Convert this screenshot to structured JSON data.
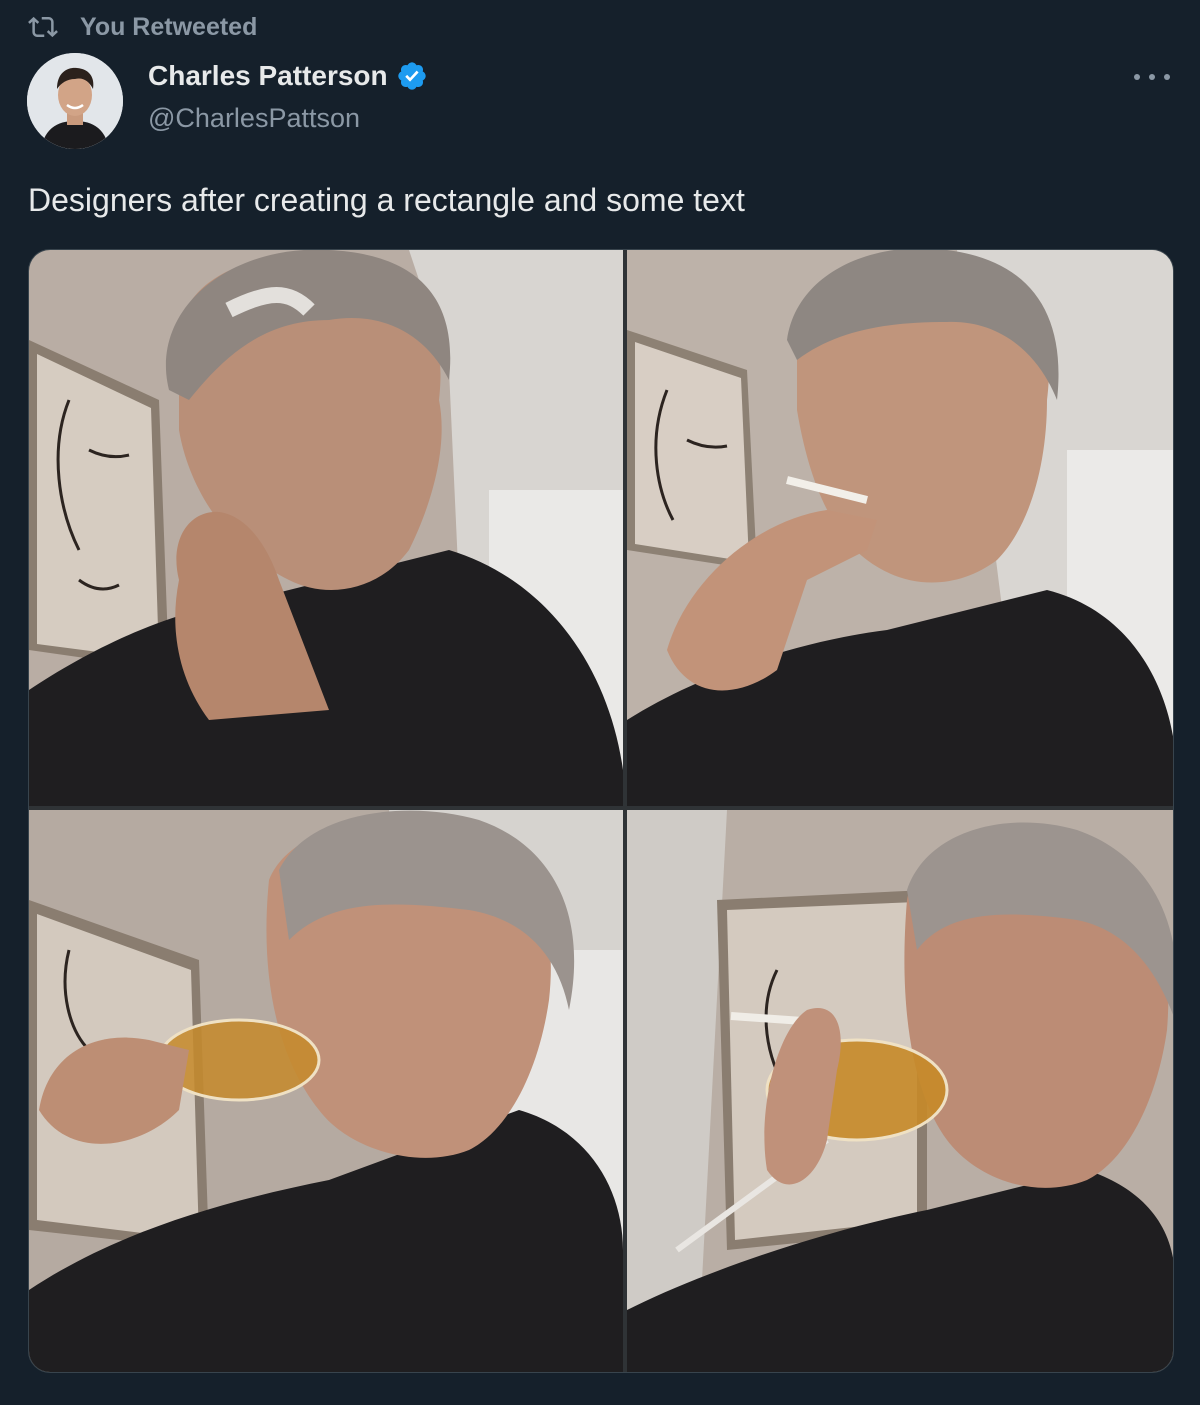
{
  "social_context": {
    "icon": "retweet-icon",
    "text": "You Retweeted"
  },
  "author": {
    "display_name": "Charles Patterson",
    "handle": "@CharlesPattson",
    "verified": true,
    "verified_icon": "verified-badge-icon",
    "avatar_icon": "avatar"
  },
  "more_icon": "more-options-icon",
  "tweet": {
    "text": "Designers after creating a rectangle and some text"
  },
  "media": {
    "count": 4,
    "items": [
      {
        "icon": "photo-man-hand-on-chin"
      },
      {
        "icon": "photo-man-smoking-cigarette"
      },
      {
        "icon": "photo-man-drinking-from-glass"
      },
      {
        "icon": "photo-man-drinking-and-smoking"
      }
    ]
  },
  "colors": {
    "background": "#15202b",
    "primary_text": "#e7e9ea",
    "secondary_text": "#8b98a5",
    "verified_blue": "#1d9bf0"
  }
}
